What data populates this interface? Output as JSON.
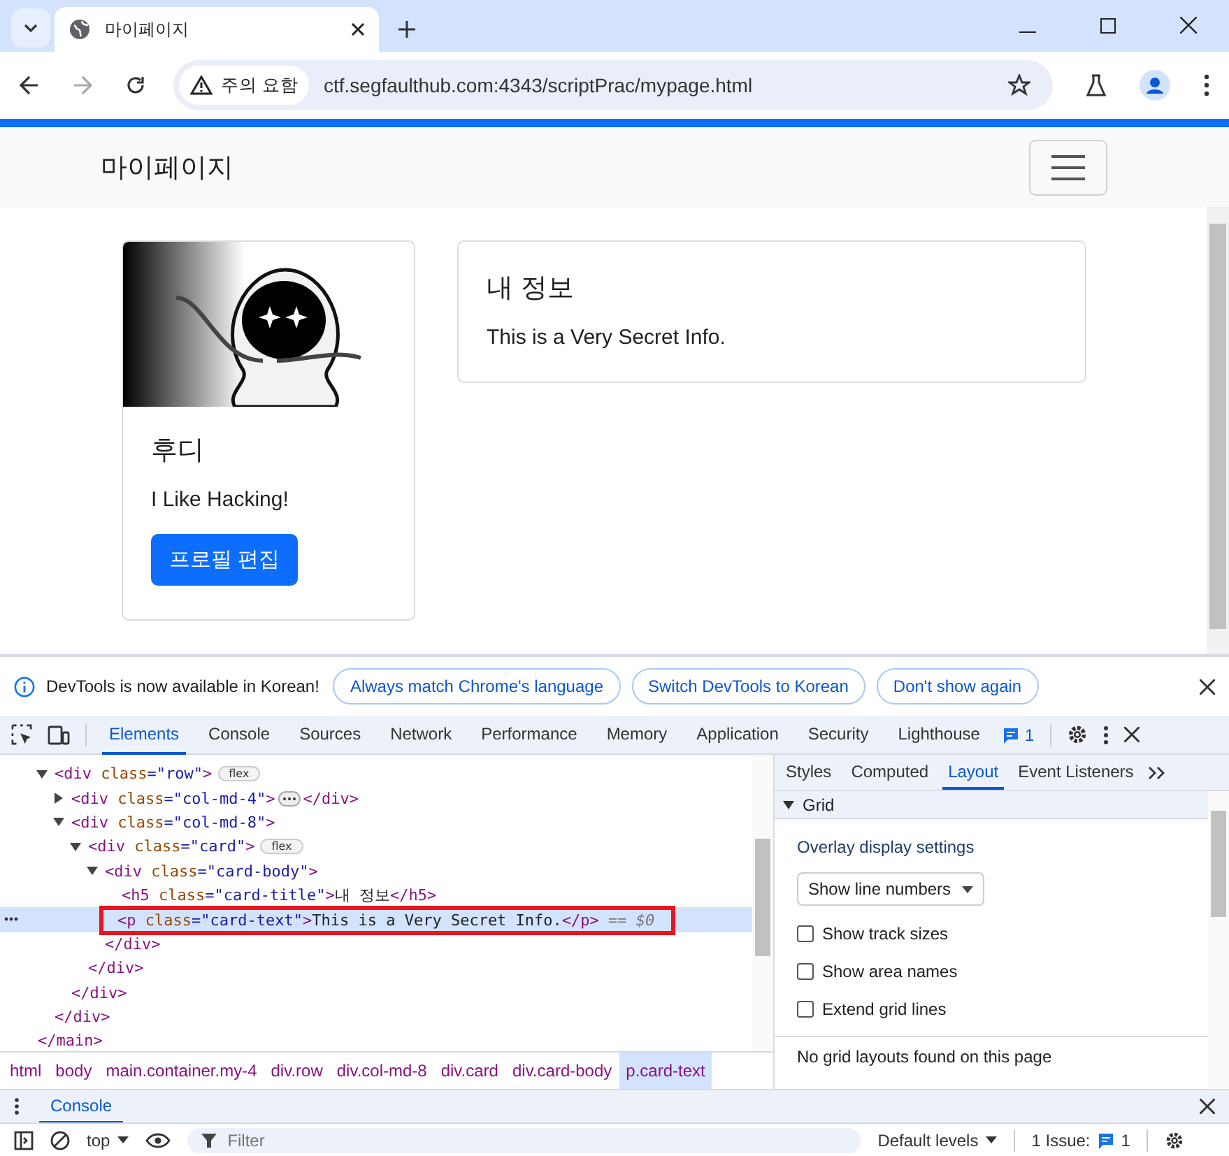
{
  "browser": {
    "tab_title": "마이페이지",
    "security_chip": "주의 요함",
    "url": "ctf.segfaulthub.com:4343/scriptPrac/mypage.html"
  },
  "page": {
    "brand": "마이페이지",
    "profile_card": {
      "name": "후디",
      "bio": "I Like Hacking!",
      "button": "프로필 편집"
    },
    "info_card": {
      "title": "내 정보",
      "text": "This is a Very Secret Info."
    }
  },
  "devtools": {
    "infobar": {
      "message": "DevTools is now available in Korean!",
      "buttons": [
        "Always match Chrome's language",
        "Switch DevTools to Korean",
        "Don't show again"
      ]
    },
    "tabs": [
      {
        "label": "Elements",
        "selected": true
      },
      {
        "label": "Console",
        "selected": false
      },
      {
        "label": "Sources",
        "selected": false
      },
      {
        "label": "Network",
        "selected": false
      },
      {
        "label": "Performance",
        "selected": false
      },
      {
        "label": "Memory",
        "selected": false
      },
      {
        "label": "Application",
        "selected": false
      },
      {
        "label": "Security",
        "selected": false
      },
      {
        "label": "Lighthouse",
        "selected": false
      }
    ],
    "issues_count": "1",
    "dom": [
      {
        "selected": false,
        "highlighted": false,
        "close": [
          {
            "kind": "tag",
            "t": "</main>"
          }
        ],
        "children": [
          {
            "selected": false,
            "highlighted": false,
            "expanded": true,
            "badge": "flex",
            "open": [
              {
                "kind": "tag",
                "t": "<div"
              },
              {
                "kind": "attr",
                "t": " class"
              },
              {
                "kind": "value",
                "t": "=\"row\""
              },
              {
                "kind": "tag",
                "t": ">"
              }
            ],
            "close": [
              {
                "kind": "tag",
                "t": "</div>"
              }
            ],
            "children": [
              {
                "selected": false,
                "highlighted": false,
                "expanded": false,
                "open": [
                  {
                    "kind": "tag",
                    "t": "<div"
                  },
                  {
                    "kind": "attr",
                    "t": " class"
                  },
                  {
                    "kind": "value",
                    "t": "=\"col-md-4\""
                  },
                  {
                    "kind": "tag",
                    "t": ">"
                  }
                ],
                "close": [
                  {
                    "kind": "tag",
                    "t": "</div>"
                  }
                ]
              },
              {
                "selected": false,
                "highlighted": false,
                "expanded": true,
                "open": [
                  {
                    "kind": "tag",
                    "t": "<div"
                  },
                  {
                    "kind": "attr",
                    "t": " class"
                  },
                  {
                    "kind": "value",
                    "t": "=\"col-md-8\""
                  },
                  {
                    "kind": "tag",
                    "t": ">"
                  }
                ],
                "close": [
                  {
                    "kind": "tag",
                    "t": "</div>"
                  }
                ],
                "children": [
                  {
                    "selected": false,
                    "highlighted": false,
                    "expanded": true,
                    "badge": "flex",
                    "open": [
                      {
                        "kind": "tag",
                        "t": "<div"
                      },
                      {
                        "kind": "attr",
                        "t": " class"
                      },
                      {
                        "kind": "value",
                        "t": "=\"card\""
                      },
                      {
                        "kind": "tag",
                        "t": ">"
                      }
                    ],
                    "close": [
                      {
                        "kind": "tag",
                        "t": "</div>"
                      }
                    ],
                    "children": [
                      {
                        "selected": false,
                        "highlighted": false,
                        "expanded": true,
                        "open": [
                          {
                            "kind": "tag",
                            "t": "<div"
                          },
                          {
                            "kind": "attr",
                            "t": " class"
                          },
                          {
                            "kind": "value",
                            "t": "=\"card-body\""
                          },
                          {
                            "kind": "tag",
                            "t": ">"
                          }
                        ],
                        "close": [
                          {
                            "kind": "tag",
                            "t": "</div>"
                          }
                        ],
                        "children": [
                          {
                            "selected": false,
                            "highlighted": false,
                            "open": [
                              {
                                "kind": "tag",
                                "t": "<h5"
                              },
                              {
                                "kind": "attr",
                                "t": " class"
                              },
                              {
                                "kind": "value",
                                "t": "=\"card-title\""
                              },
                              {
                                "kind": "tag",
                                "t": ">"
                              },
                              {
                                "kind": "text",
                                "t": "내 정보"
                              },
                              {
                                "kind": "tag",
                                "t": "</h5>"
                              }
                            ]
                          },
                          {
                            "selected": true,
                            "highlighted": true,
                            "ref": "== $0",
                            "open": [
                              {
                                "kind": "tag",
                                "t": "<p"
                              },
                              {
                                "kind": "attr",
                                "t": " class"
                              },
                              {
                                "kind": "value",
                                "t": "=\"card-text\""
                              },
                              {
                                "kind": "tag",
                                "t": ">"
                              },
                              {
                                "kind": "text",
                                "t": "This is a Very Secret Info."
                              },
                              {
                                "kind": "tag",
                                "t": "</p>"
                              }
                            ]
                          }
                        ]
                      }
                    ]
                  }
                ]
              }
            ]
          }
        ]
      }
    ],
    "side_tabs": [
      {
        "label": "Styles",
        "selected": false
      },
      {
        "label": "Computed",
        "selected": false
      },
      {
        "label": "Layout",
        "selected": true
      },
      {
        "label": "Event Listeners",
        "selected": false
      }
    ],
    "layout": {
      "section": "Grid",
      "expanded": true,
      "overlay_title": "Overlay display settings",
      "select": "Show line numbers",
      "options": [
        {
          "label": "Show track sizes",
          "checked": false
        },
        {
          "label": "Show area names",
          "checked": false
        },
        {
          "label": "Extend grid lines",
          "checked": false
        }
      ],
      "empty_message": "No grid layouts found on this page"
    },
    "breadcrumbs": [
      {
        "label": "html",
        "selected": false
      },
      {
        "label": "body",
        "selected": false
      },
      {
        "label": "main.container.my-4",
        "selected": false
      },
      {
        "label": "div.row",
        "selected": false
      },
      {
        "label": "div.col-md-8",
        "selected": false
      },
      {
        "label": "div.card",
        "selected": false
      },
      {
        "label": "div.card-body",
        "selected": false
      },
      {
        "label": "p.card-text",
        "selected": true
      }
    ],
    "drawer": {
      "tab": "Console",
      "context": "top",
      "filter_placeholder": "Filter",
      "levels": "Default levels",
      "issues_label": "1 Issue:",
      "issues_count": "1"
    }
  }
}
